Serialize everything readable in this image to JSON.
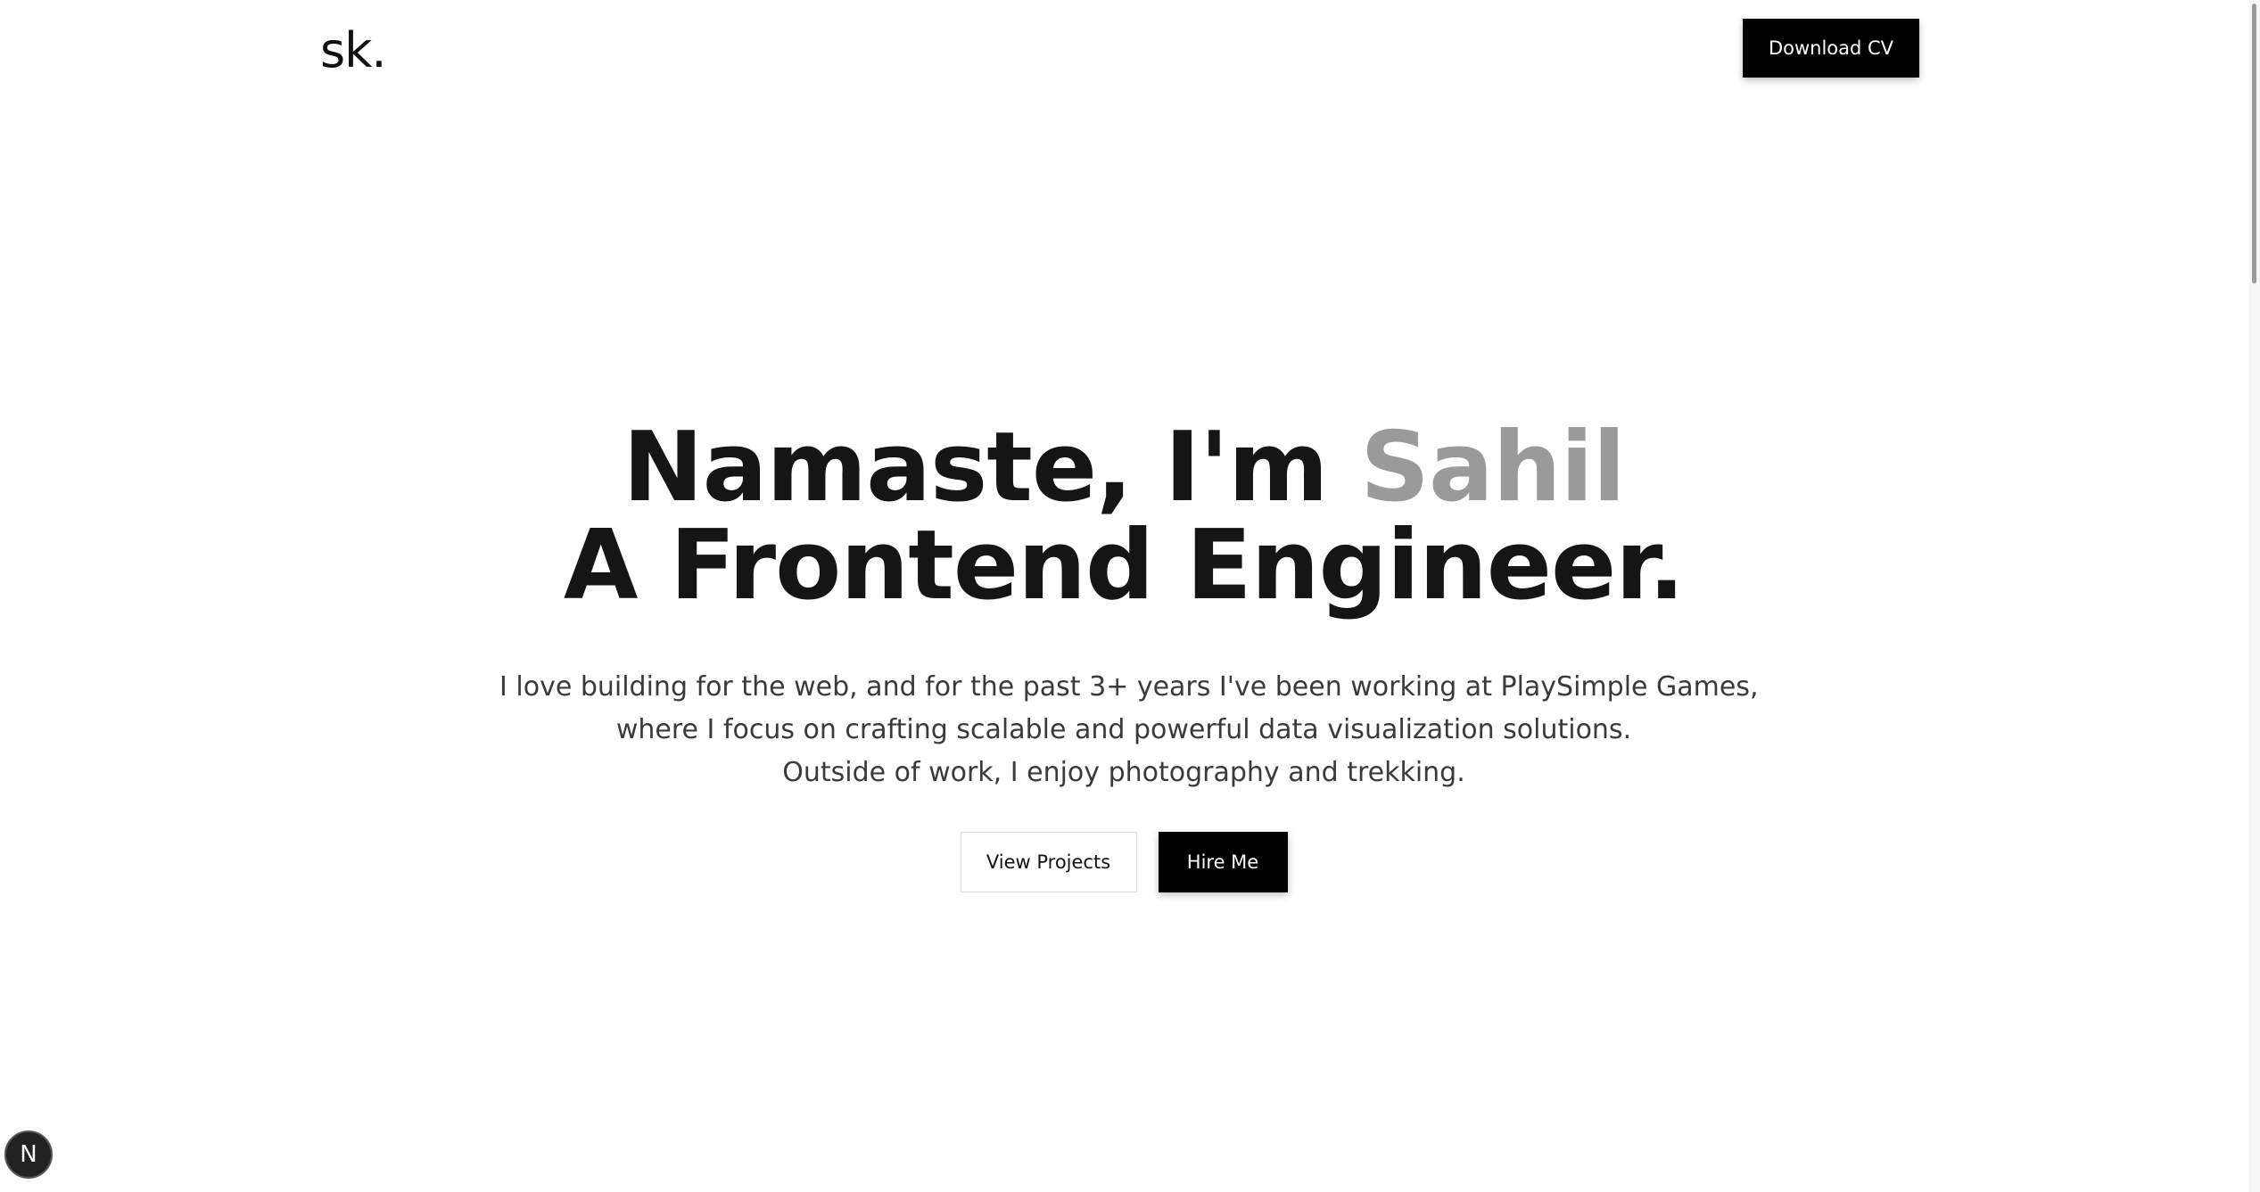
{
  "header": {
    "logo": "sk.",
    "download_cv_label": "Download CV"
  },
  "hero": {
    "headline_prefix": "Namaste, I'm ",
    "headline_name": "Sahil",
    "headline_line2": "A Frontend Engineer.",
    "intro_lines": [
      "I love building for the web, and for the past 3+ years I've been working at PlaySimple Games,",
      "where I focus on crafting scalable and powerful data visualization solutions.",
      "Outside of work, I enjoy photography and trekking."
    ],
    "view_projects_label": "View Projects",
    "hire_me_label": "Hire Me"
  },
  "dev_badge": {
    "glyph": "N",
    "icon": "nextjs-icon"
  },
  "colors": {
    "accent_name": "#9a9a9a",
    "button_bg": "#000000",
    "text": "#151515"
  }
}
